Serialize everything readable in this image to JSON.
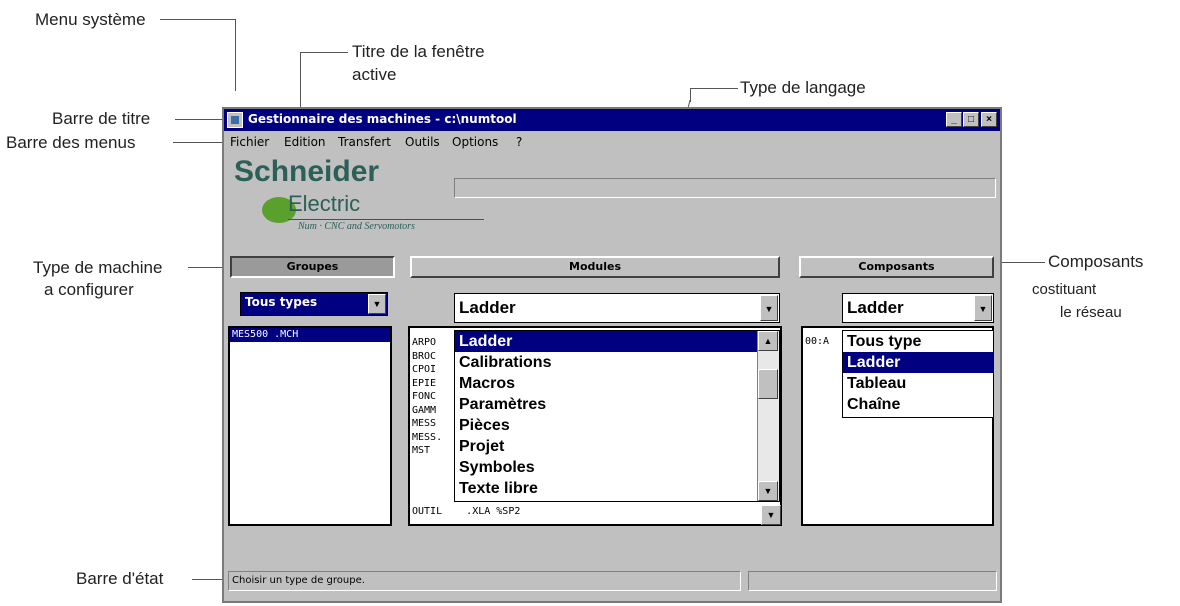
{
  "annotations": {
    "menu_systeme": "Menu système",
    "titre_fenetre_1": "Titre de la fenêtre",
    "titre_fenetre_2": "active",
    "type_langage": "Type de langage",
    "barre_titre": "Barre de titre",
    "barre_menus": "Barre des menus",
    "type_machine_1": "Type de machine",
    "type_machine_2": "a configurer",
    "composants": "Composants",
    "composants_sub1": "costituant",
    "composants_sub2": "le réseau",
    "barre_etat": "Barre d'état"
  },
  "window": {
    "title": "Gestionnaire des machines - c:\\numtool",
    "buttons": [
      "minimize-icon",
      "maximize-icon",
      "close-icon"
    ]
  },
  "menubar": {
    "items": [
      "Fichier",
      "Edition",
      "Transfert",
      "Outils",
      "Options",
      "?"
    ]
  },
  "logo": {
    "brand": "Schneider",
    "brand2": "Electric",
    "tagline": "Num · CNC and Servomotors"
  },
  "groupes": {
    "header": "Groupes",
    "filter": "Tous types",
    "items": [
      "MES500   .MCH"
    ]
  },
  "modules": {
    "header": "Modules",
    "filter": "Ladder",
    "list_prefixes": [
      "ARPO",
      "BROC",
      "CPOI",
      "EPIE",
      "FONC",
      "GAMM",
      "MESS",
      "MESS.",
      "MST"
    ],
    "last_row": "OUTIL    .XLA %SP2",
    "dropdown_items": [
      "Ladder",
      "Calibrations",
      "Macros",
      "Paramètres",
      "Pièces",
      "Projet",
      "Symboles",
      "Texte libre"
    ],
    "dropdown_selected": 0
  },
  "composants": {
    "header": "Composants",
    "filter": "Ladder",
    "list_first": "00:A",
    "dropdown_items": [
      "Tous type",
      "Ladder",
      "Tableau",
      "Chaîne"
    ],
    "dropdown_selected": 1
  },
  "status": {
    "text": "Choisir un type de groupe."
  },
  "colors": {
    "titlebar": "#000080",
    "window_bg": "#c0c0c0",
    "logo_text": "#2b5f57",
    "logo_green": "#5aa02c"
  }
}
